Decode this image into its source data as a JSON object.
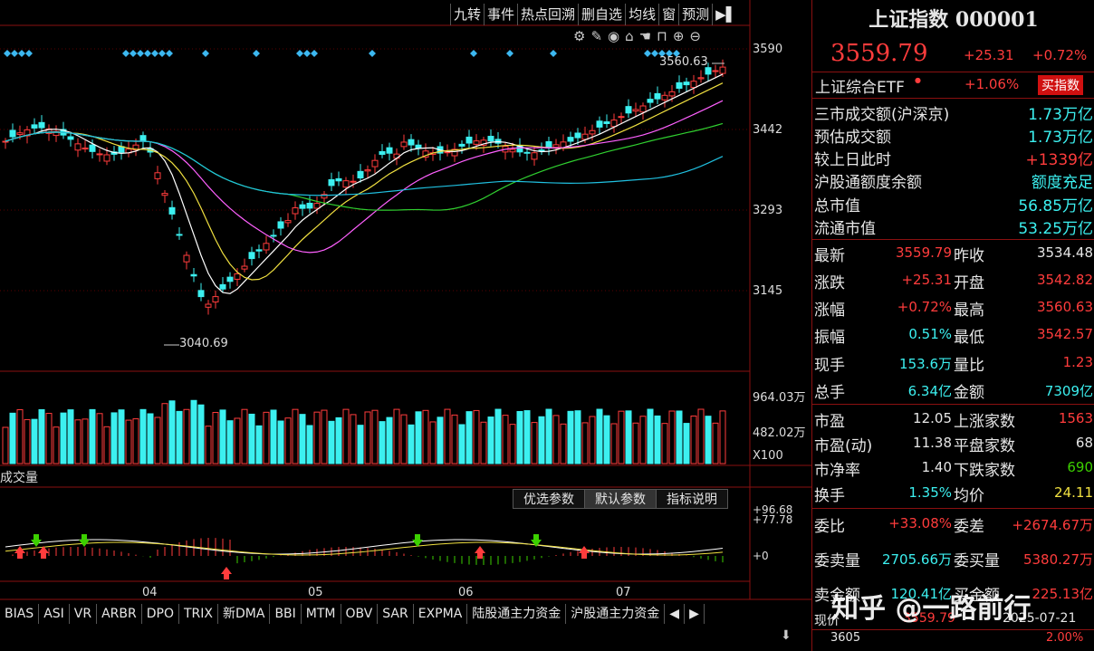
{
  "toolbar": [
    "九转",
    "事件",
    "热点回溯",
    "删自选",
    "均线",
    "窗",
    "预测",
    "▶▌"
  ],
  "price_axis": [
    "3590",
    "3442",
    "3293",
    "3145"
  ],
  "vol_axis": [
    "964.03万",
    "482.02万",
    "X100"
  ],
  "macd_axis": [
    "+96.68",
    "+77.78",
    "+0"
  ],
  "month_labels": [
    "04",
    "05",
    "06",
    "07"
  ],
  "annotations": {
    "high": "3560.63",
    "low": "3040.69",
    "vol_title": "成交量"
  },
  "params": [
    "优选参数",
    "默认参数",
    "指标说明"
  ],
  "indicators": [
    "BIAS",
    "ASI",
    "VR",
    "ARBR",
    "DPO",
    "TRIX",
    "新DMA",
    "BBI",
    "MTM",
    "OBV",
    "SAR",
    "EXPMA",
    "陆股通主力资金",
    "沪股通主力资金"
  ],
  "header": {
    "title": "上证指数 000001",
    "price": "3559.79",
    "chg": "+25.31",
    "pct": "+0.72%"
  },
  "etf": {
    "label": "上证综合ETF",
    "pct": "+1.06%",
    "btn": "买指数"
  },
  "market": [
    {
      "k": "三市成交额(沪深京)",
      "v": "1.73万亿"
    },
    {
      "k": "预估成交额",
      "v": "1.73万亿"
    },
    {
      "k": "较上日此时",
      "v": "+1339亿"
    },
    {
      "k": "沪股通额度余额",
      "v": "额度充足"
    },
    {
      "k": "总市值",
      "v": "56.85万亿"
    },
    {
      "k": "流通市值",
      "v": "53.25万亿"
    }
  ],
  "quote": [
    {
      "k1": "最新",
      "v1": "3559.79",
      "k2": "昨收",
      "v2": "3534.48"
    },
    {
      "k1": "涨跌",
      "v1": "+25.31",
      "k2": "开盘",
      "v2": "3542.82"
    },
    {
      "k1": "涨幅",
      "v1": "+0.72%",
      "k2": "最高",
      "v2": "3560.63"
    },
    {
      "k1": "振幅",
      "v1": "0.51%",
      "k2": "最低",
      "v2": "3542.57"
    },
    {
      "k1": "现手",
      "v1": "153.6万",
      "k2": "量比",
      "v2": "1.23"
    },
    {
      "k1": "总手",
      "v1": "6.34亿",
      "k2": "金额",
      "v2": "7309亿"
    }
  ],
  "val": [
    {
      "k1": "市盈",
      "v1": "12.05",
      "k2": "上涨家数",
      "v2": "1563"
    },
    {
      "k1": "市盈(动)",
      "v1": "11.38",
      "k2": "平盘家数",
      "v2": "68"
    },
    {
      "k1": "市净率",
      "v1": "1.40",
      "k2": "下跌家数",
      "v2": "690"
    },
    {
      "k1": "换手",
      "v1": "1.35%",
      "k2": "均价",
      "v2": "24.11"
    }
  ],
  "order": [
    {
      "k1": "委比",
      "v1": "+33.08%",
      "k2": "委差",
      "v2": "+2674.67万"
    },
    {
      "k1": "委卖量",
      "v1": "2705.66万",
      "k2": "委买量",
      "v2": "5380.27万"
    },
    {
      "k1": "卖金额",
      "v1": "120.41亿",
      "k2": "买金额",
      "v2": "225.13亿"
    }
  ],
  "bottom": {
    "k1": "现价",
    "v1": "3559.79",
    "v2": "2025-07-21",
    "n1": "3605",
    "n2": "2.00%"
  },
  "watermark": "知乎 @一路前行"
}
